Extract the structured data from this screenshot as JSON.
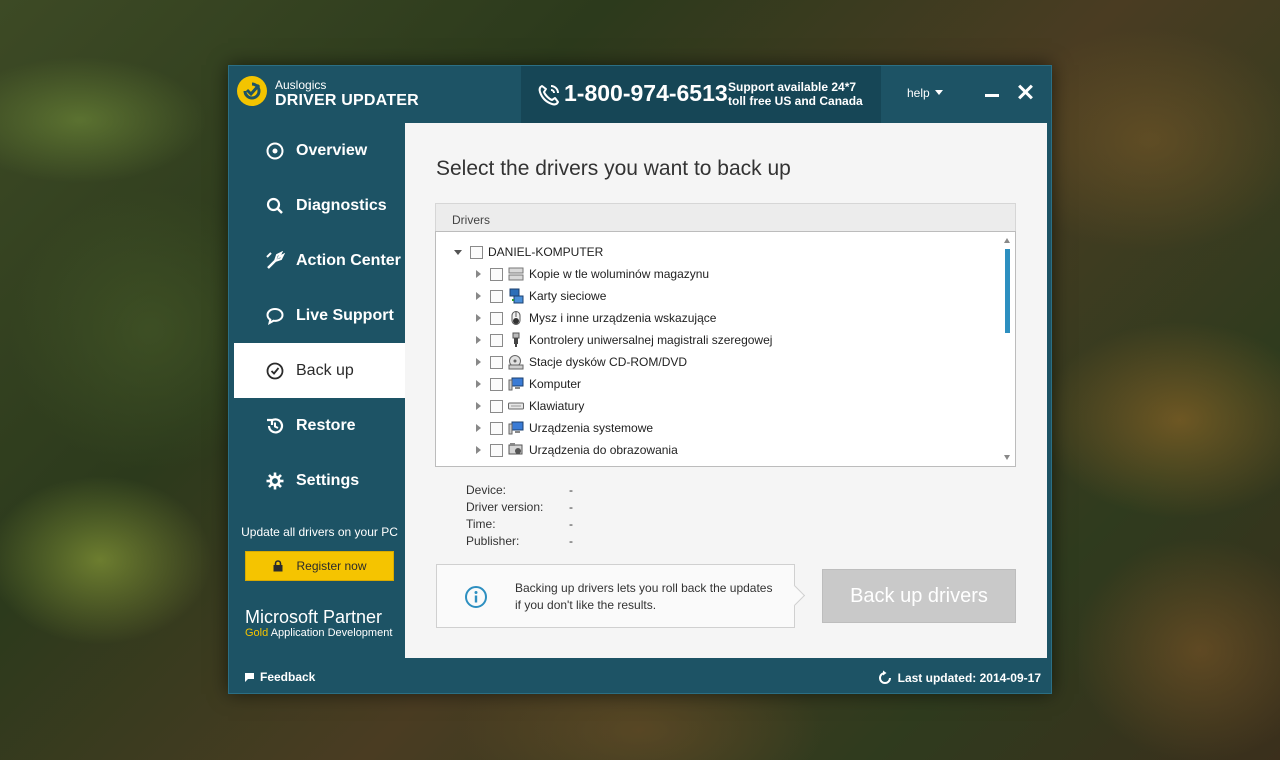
{
  "brand": {
    "company": "Auslogics",
    "product": "DRIVER UPDATER"
  },
  "header": {
    "phone": "1-800-974-6513",
    "support_line1": "Support available 24*7",
    "support_line2": "toll free US and Canada",
    "help_label": "help"
  },
  "sidebar": {
    "items": [
      {
        "label": "Overview",
        "icon": "target-icon"
      },
      {
        "label": "Diagnostics",
        "icon": "search-icon"
      },
      {
        "label": "Action Center",
        "icon": "wrench-icon"
      },
      {
        "label": "Live Support",
        "icon": "chat-icon"
      },
      {
        "label": "Back up",
        "icon": "clock-check-icon",
        "active": true
      },
      {
        "label": "Restore",
        "icon": "restore-icon"
      },
      {
        "label": "Settings",
        "icon": "gear-icon"
      }
    ],
    "update_text": "Update all drivers on your PC",
    "register_label": "Register now",
    "partner_title": "Microsoft Partner",
    "partner_gold": "Gold",
    "partner_sub": " Application Development"
  },
  "main": {
    "title": "Select the drivers you want to back up",
    "drivers_header": "Drivers",
    "root": "DANIEL-KOMPUTER",
    "tree_items": [
      "Kopie w tle woluminów magazynu",
      "Karty sieciowe",
      "Mysz i inne urządzenia wskazujące",
      "Kontrolery uniwersalnej magistrali szeregowej",
      "Stacje dysków CD-ROM/DVD",
      "Komputer",
      "Klawiatury",
      "Urządzenia systemowe",
      "Urządzenia do obrazowania"
    ],
    "info": {
      "device_label": "Device:",
      "device_value": "-",
      "version_label": "Driver version:",
      "version_value": "-",
      "time_label": "Time:",
      "time_value": "-",
      "publisher_label": "Publisher:",
      "publisher_value": "-"
    },
    "note": "Backing up drivers lets you roll back the updates if you don't like the results.",
    "backup_button": "Back up drivers"
  },
  "footer": {
    "feedback": "Feedback",
    "last_updated": "Last updated: 2014-09-17"
  },
  "colors": {
    "frame": "#1d5365",
    "phone_bg": "#164656",
    "accent_yellow": "#f5c400",
    "scroll_thumb": "#2d8fc0",
    "button_disabled": "#c9c9c9"
  }
}
